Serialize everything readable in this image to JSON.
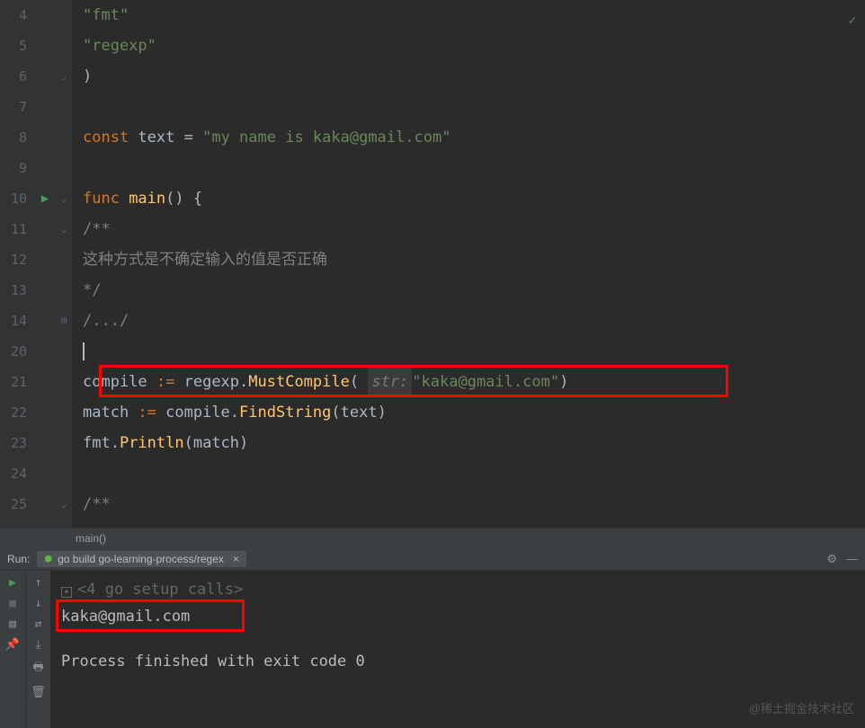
{
  "gutter_lines": [
    "4",
    "5",
    "6",
    "7",
    "8",
    "9",
    "10",
    "11",
    "12",
    "13",
    "14",
    "20",
    "21",
    "22",
    "23",
    "24",
    "25"
  ],
  "code": {
    "l4": "\"fmt\"",
    "l5": "\"regexp\"",
    "l6": ")",
    "l8_kw": "const",
    "l8_id": " text ",
    "l8_eq": "= ",
    "l8_str": "\"my name is kaka@gmail.com\"",
    "l10_kw": "func",
    "l10_fn": " main",
    "l10_rest": "() {",
    "l11": "/**",
    "l12": "这种方式是不确定输入的值是否正确",
    "l13": "*/",
    "l14": "/.../",
    "l21_a": "compile ",
    "l21_assign": ":=",
    "l21_b": " regexp.",
    "l21_fn": "MustCompile",
    "l21_c": "( ",
    "l21_hint": "str:",
    "l21_str": "\"kaka@gmail.com\"",
    "l21_end": ")",
    "l22_a": "match ",
    "l22_assign": ":=",
    "l22_b": " compile.",
    "l22_fn": "FindString",
    "l22_args": "(text)",
    "l23_a": "fmt.",
    "l23_fn": "Println",
    "l23_args": "(match)",
    "l25": "/**"
  },
  "breadcrumb": "main()",
  "run": {
    "label": "Run:",
    "tab": "go build go-learning-process/regex",
    "line1": "<4 go setup calls>",
    "line2": "kaka@gmail.com",
    "line3": "Process finished with exit code 0"
  },
  "watermark": "@稀土掘金技术社区"
}
